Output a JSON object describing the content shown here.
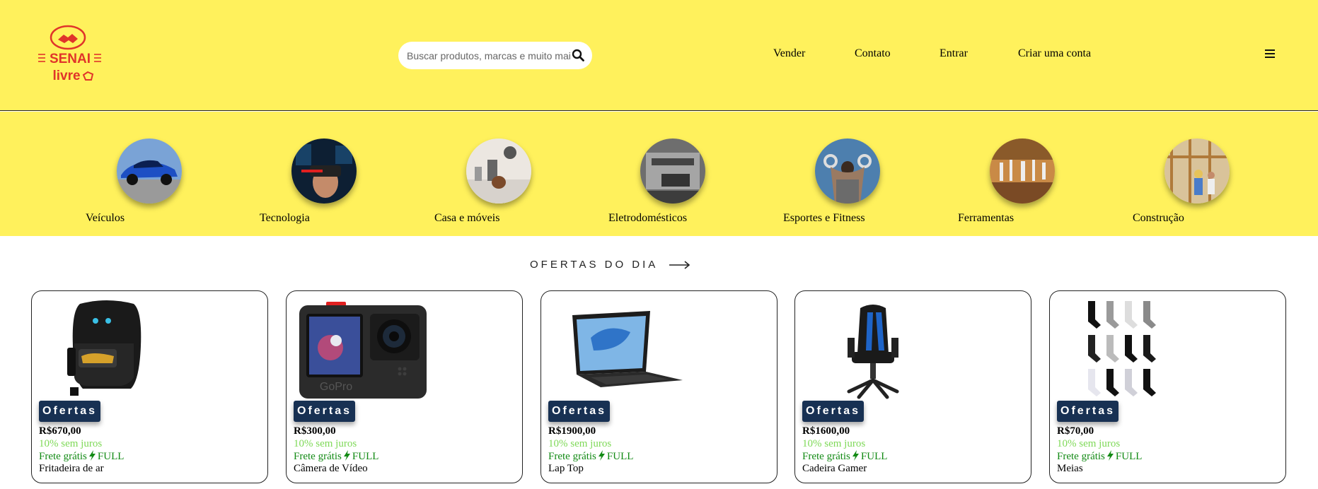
{
  "header": {
    "logo_text_1": "SENAI",
    "logo_text_2": "livre",
    "search_placeholder": "Buscar produtos, marcas e muito mais",
    "nav": [
      "Vender",
      "Contato",
      "Entrar",
      "Criar uma conta"
    ],
    "menu_icon": "hamburger-icon",
    "search_icon": "magnifier-icon"
  },
  "categories": [
    {
      "label": "Veículos",
      "icon": "car-photo"
    },
    {
      "label": "Tecnologia",
      "icon": "vr-headset-photo"
    },
    {
      "label": "Casa e móveis",
      "icon": "kitchen-photo"
    },
    {
      "label": "Eletrodomésticos",
      "icon": "appliance-photo"
    },
    {
      "label": "Esportes e Fitness",
      "icon": "gym-rings-photo"
    },
    {
      "label": "Ferramentas",
      "icon": "tools-photo"
    },
    {
      "label": "Construção",
      "icon": "construction-photo"
    }
  ],
  "offers": {
    "title": "OFERTAS DO DIA",
    "badge": "Ofertas",
    "installments": "10% sem juros",
    "shipping": "Frete grátis",
    "shipping_tag": "FULL",
    "products": [
      {
        "price": "R$670,00",
        "name": "Fritadeira de ar",
        "image": "air-fryer"
      },
      {
        "price": "R$300,00",
        "name": "Câmera de Vídeo",
        "image": "action-camera"
      },
      {
        "price": "R$1900,00",
        "name": "Lap Top",
        "image": "laptop"
      },
      {
        "price": "R$1600,00",
        "name": "Cadeira Gamer",
        "image": "gamer-chair"
      },
      {
        "price": "R$70,00",
        "name": "Meias",
        "image": "socks"
      }
    ]
  },
  "colors": {
    "header_bg": "#fff15c",
    "badge_bg": "#183153",
    "installments": "#7ed957",
    "shipping": "#128a14",
    "logo": "#e0342a"
  }
}
